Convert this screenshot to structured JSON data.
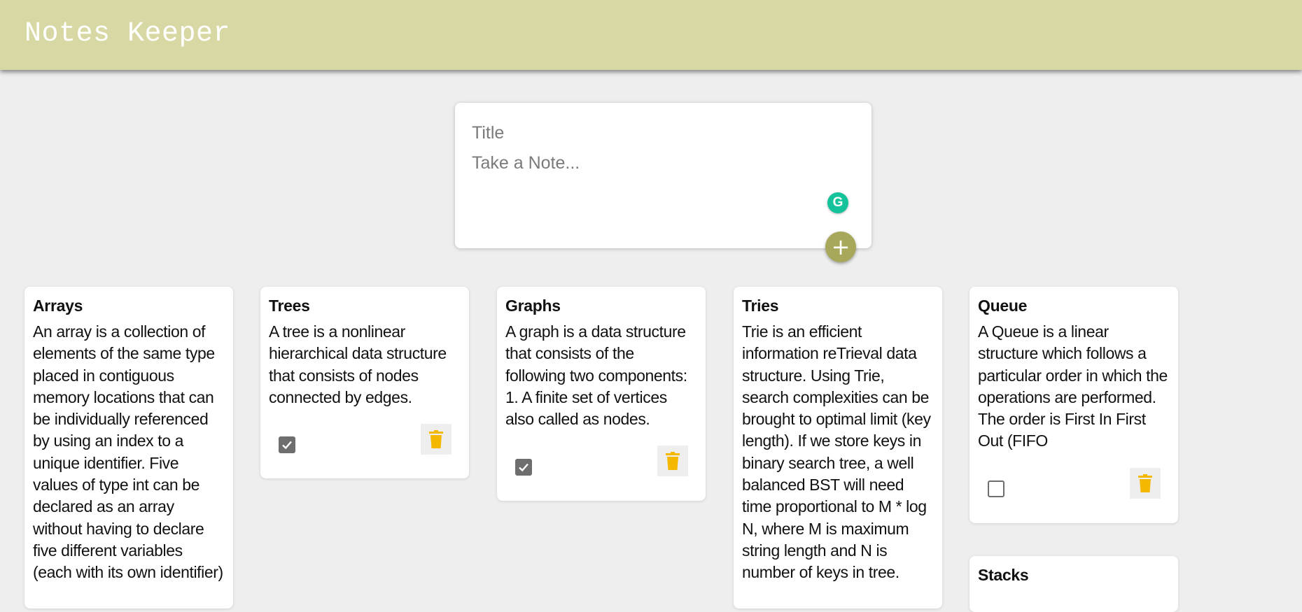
{
  "app": {
    "title": "Notes Keeper"
  },
  "composer": {
    "title_placeholder": "Title",
    "note_placeholder": "Take a Note...",
    "assistant_badge": "G",
    "add_label": "+"
  },
  "notes": [
    {
      "title": "Arrays",
      "body": "An array is a collection of elements of the same type placed in contiguous memory locations that can be individually referenced by using an index to a unique identifier. Five values of type int can be declared as an array without having to declare five different variables (each with its own identifier)",
      "checked": null
    },
    {
      "title": "Trees",
      "body": "A tree is a nonlinear hierarchical data structure that consists of nodes connected by edges.",
      "checked": true
    },
    {
      "title": "Graphs",
      "body": "A graph is a data structure that consists of the following two components: 1. A finite set of vertices also called as nodes.",
      "checked": true
    },
    {
      "title": "Tries",
      "body": "Trie is an efficient information reTrieval data structure. Using Trie, search complexities can be brought to optimal limit (key length). If we store keys in binary search tree, a well balanced BST will need time proportional to M * log N, where M is maximum string length and N is number of keys in tree.",
      "checked": null
    },
    {
      "title": "Queue",
      "body": "A Queue is a linear structure which follows a particular order in which the operations are performed. The order is First In First Out (FIFO",
      "checked": false
    },
    {
      "title": "Stacks",
      "body": "",
      "checked": null
    }
  ],
  "colors": {
    "header": "#d8d8a4",
    "background": "#eeeeee",
    "add_button": "#a8a85a",
    "trash_icon": "#f5b800",
    "assistant_badge": "#15c39a"
  }
}
